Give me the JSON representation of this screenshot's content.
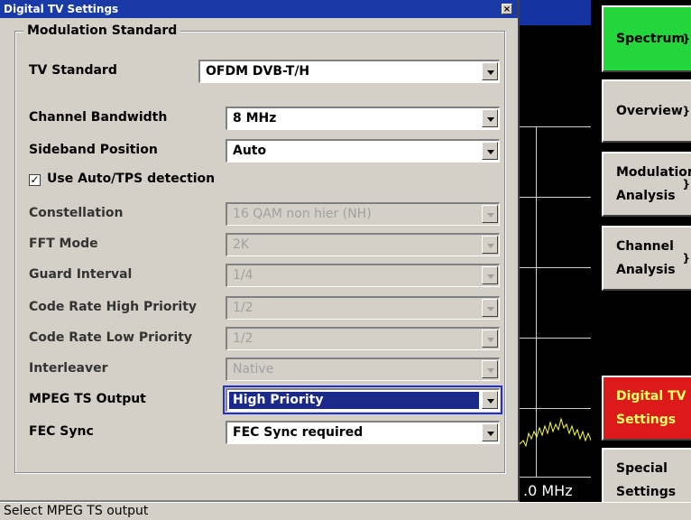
{
  "dialog": {
    "title": "Digital TV Settings",
    "close_glyph": "×",
    "group_title": "Modulation Standard",
    "fields": {
      "tv_standard": {
        "label": "TV Standard",
        "value": "OFDM DVB-T/H"
      },
      "channel_bandwidth": {
        "label": "Channel Bandwidth",
        "value": "8 MHz"
      },
      "sideband_position": {
        "label": "Sideband Position",
        "value": "Auto"
      },
      "auto_tps": {
        "label": "Use Auto/TPS detection",
        "checked": true,
        "check_glyph": "✓"
      },
      "constellation": {
        "label": "Constellation",
        "value": "16 QAM non hier (NH)"
      },
      "fft_mode": {
        "label": "FFT Mode",
        "value": "2K"
      },
      "guard_interval": {
        "label": "Guard Interval",
        "value": "1/4"
      },
      "code_rate_high": {
        "label": "Code Rate High Priority",
        "value": "1/2"
      },
      "code_rate_low": {
        "label": "Code Rate Low Priority",
        "value": "1/2"
      },
      "interleaver": {
        "label": "Interleaver",
        "value": "Native"
      },
      "mpeg_ts_output": {
        "label": "MPEG TS Output",
        "value": "High Priority"
      },
      "fec_sync": {
        "label": "FEC Sync",
        "value": "FEC Sync required"
      }
    }
  },
  "softkeys": {
    "spectrum": "Spectrum",
    "overview": "Overview",
    "modulation_1": "Modulation",
    "modulation_2": "Analysis",
    "channel_1": "Channel",
    "channel_2": "Analysis",
    "digital_1": "Digital TV",
    "digital_2": "Settings",
    "special_1": "Special",
    "special_2": "Settings",
    "arrow_glyph": "}"
  },
  "trace": {
    "freq_label": ".0 MHz"
  },
  "status": {
    "text": "Select MPEG TS output"
  },
  "colors": {
    "dialog_bg": "#d4d0c8",
    "title_bar": "#1a3aa8",
    "spectrum_key": "#22d63b",
    "digital_key": "#dc1a1a",
    "selection": "#1b2a8a"
  }
}
